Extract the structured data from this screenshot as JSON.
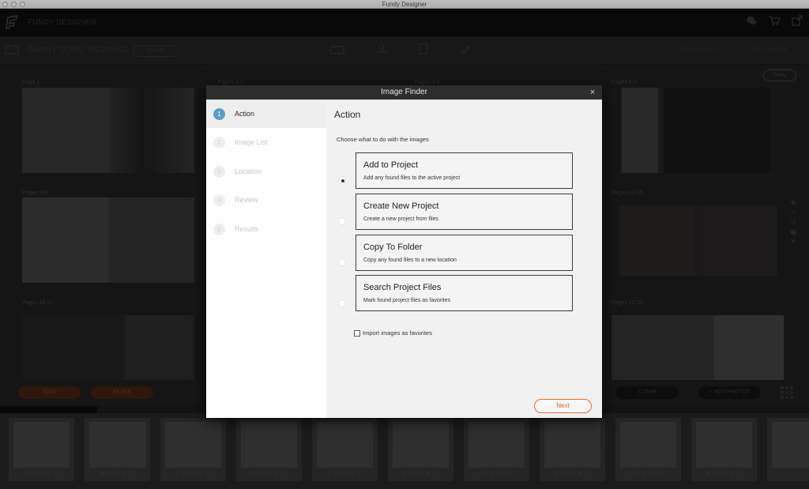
{
  "window": {
    "title": "Fundy Designer"
  },
  "app": {
    "brand": "FUNDY DESIGNER"
  },
  "header_icons": [
    "chat-icon",
    "cart-icon",
    "external-link-icon"
  ],
  "project": {
    "title": "DANNY DONG WEDDING",
    "badge": "ALBUM",
    "stats": [
      "TOTAL IMAGES",
      "TOTAL PAGES"
    ]
  },
  "view_button": "View",
  "pages": {
    "labels": [
      "Page 1",
      "Pages 2-3",
      "Pages 4-5",
      "Pages 6-7",
      "Pages 8-9",
      "Pages 14-15",
      "Pages 16-17",
      "Pages 22-23"
    ]
  },
  "bottom": {
    "sort": "SORT",
    "filter": "FILTER",
    "clear": "CLEAR",
    "add_photos": "+ ADD PHOTOS",
    "rating": "☆☆☆☆☆  ♡"
  },
  "dialog": {
    "title": "Image Finder",
    "close": "×",
    "steps": [
      {
        "num": "1",
        "label": "Action"
      },
      {
        "num": "2",
        "label": "Image List"
      },
      {
        "num": "3",
        "label": "Location"
      },
      {
        "num": "4",
        "label": "Review"
      },
      {
        "num": "5",
        "label": "Results"
      }
    ],
    "section_title": "Action",
    "instruction": "Choose what to do with the images",
    "options": [
      {
        "title": "Add to Project",
        "desc": "Add any found files to the active project",
        "selected": true
      },
      {
        "title": "Create New Project",
        "desc": "Create a new project from files",
        "selected": false
      },
      {
        "title": "Copy To Folder",
        "desc": "Copy any found files to a new location",
        "selected": false
      },
      {
        "title": "Search Project Files",
        "desc": "Mark found project files as favorites",
        "selected": false
      }
    ],
    "favorites_label": "Import images as favorites",
    "favorites_checked": false,
    "next": "Next"
  },
  "colors": {
    "accent": "#5b9dc6",
    "next_orange": "#ee6a2d",
    "dialog_header": "#2d2d2d"
  }
}
